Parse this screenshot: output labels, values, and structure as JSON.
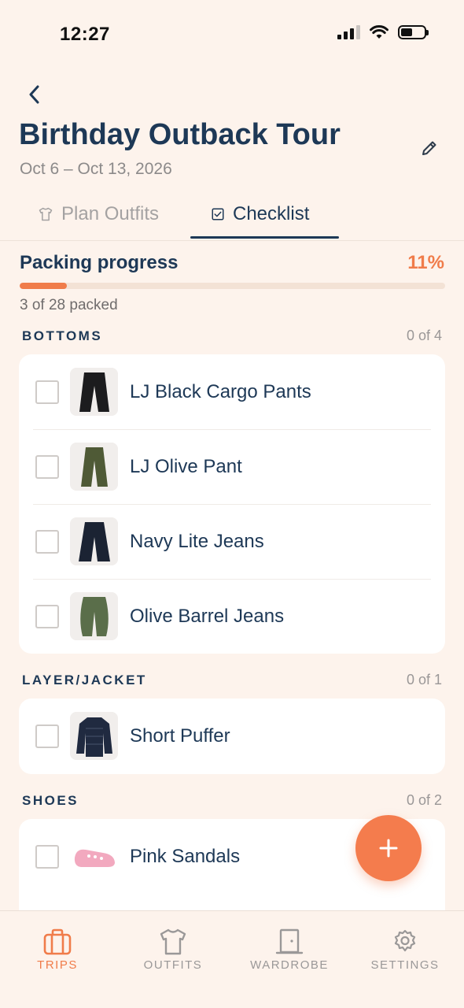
{
  "status_bar": {
    "time": "12:27"
  },
  "header": {
    "title": "Birthday Outback Tour",
    "dates": "Oct 6 – Oct 13, 2026"
  },
  "tabs": [
    {
      "label": "Plan Outfits",
      "icon": "shirt-icon",
      "active": false
    },
    {
      "label": "Checklist",
      "icon": "checkbox-icon",
      "active": true
    }
  ],
  "progress": {
    "label": "Packing progress",
    "percent_text": "11%",
    "fraction": 0.11,
    "summary": "3 of 28 packed"
  },
  "sections": [
    {
      "title": "BOTTOMS",
      "count": "0 of 4",
      "items": [
        {
          "name": "LJ Black Cargo Pants",
          "checked": false,
          "color": "#1c1c1e"
        },
        {
          "name": "LJ Olive Pant",
          "checked": false,
          "color": "#4f5a36"
        },
        {
          "name": "Navy Lite Jeans",
          "checked": false,
          "color": "#1b2333"
        },
        {
          "name": "Olive Barrel Jeans",
          "checked": false,
          "color": "#5a6e4a"
        }
      ]
    },
    {
      "title": "LAYER/JACKET",
      "count": "0 of 1",
      "items": [
        {
          "name": "Short Puffer",
          "checked": false,
          "color": "#202a40"
        }
      ]
    },
    {
      "title": "SHOES",
      "count": "0 of 2",
      "items": [
        {
          "name": "Pink Sandals",
          "checked": false,
          "color": "#f2a9bf"
        }
      ]
    }
  ],
  "bottom_nav": [
    {
      "label": "TRIPS",
      "icon": "suitcase-icon",
      "active": true
    },
    {
      "label": "OUTFITS",
      "icon": "shirt-icon",
      "active": false
    },
    {
      "label": "WARDROBE",
      "icon": "wardrobe-icon",
      "active": false
    },
    {
      "label": "SETTINGS",
      "icon": "gear-icon",
      "active": false
    }
  ],
  "colors": {
    "accent": "#f07c4a",
    "navy": "#1d3856",
    "background": "#fdf3ec"
  }
}
